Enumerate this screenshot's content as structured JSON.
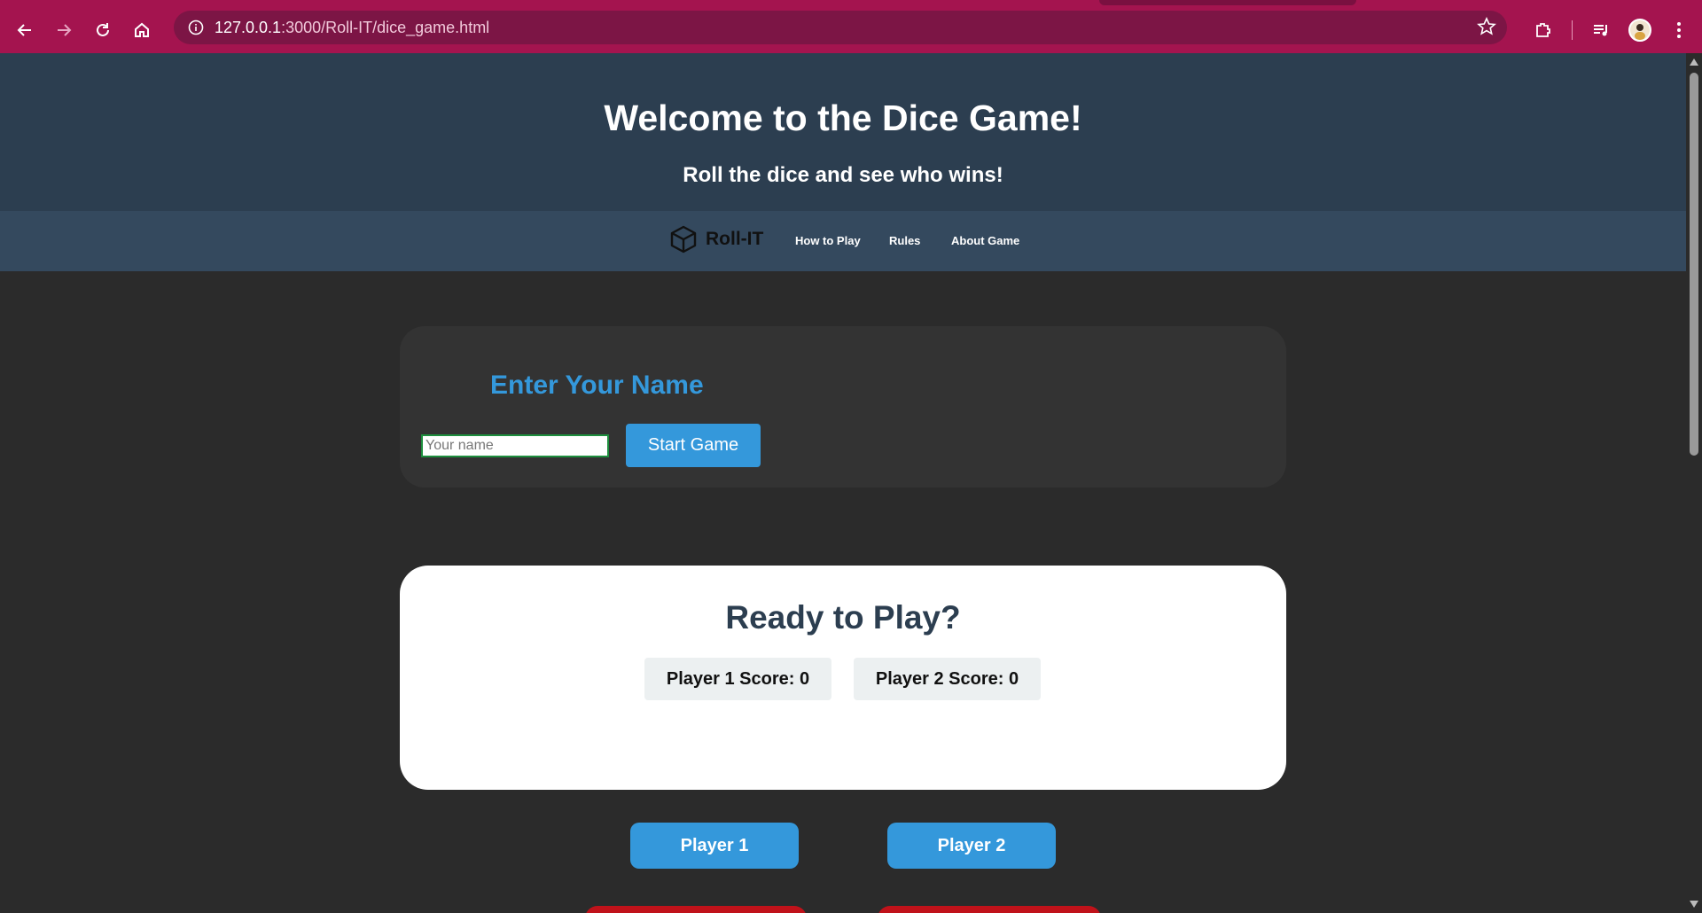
{
  "browser": {
    "url_host": "127.0.0.1",
    "url_path": ":3000/Roll-IT/dice_game.html"
  },
  "header": {
    "title": "Welcome to the Dice Game!",
    "subtitle": "Roll the dice and see who wins!"
  },
  "nav": {
    "brand": "Roll-IT",
    "links": [
      "How to Play",
      "Rules",
      "About Game"
    ]
  },
  "name_form": {
    "heading": "Enter Your Name",
    "placeholder": "Your name",
    "value": "",
    "button": "Start Game"
  },
  "game": {
    "heading": "Ready to Play?",
    "scores": [
      "Player 1 Score: 0",
      "Player 2 Score: 0"
    ]
  },
  "players": {
    "player1": "Player 1",
    "player2": "Player 2"
  },
  "colors": {
    "browser_accent": "#a4144f",
    "header_bg": "#2c3e50",
    "nav_bg": "#34495e",
    "primary": "#3498db",
    "page_bg": "#2b2b2b",
    "danger": "#c0121a"
  }
}
